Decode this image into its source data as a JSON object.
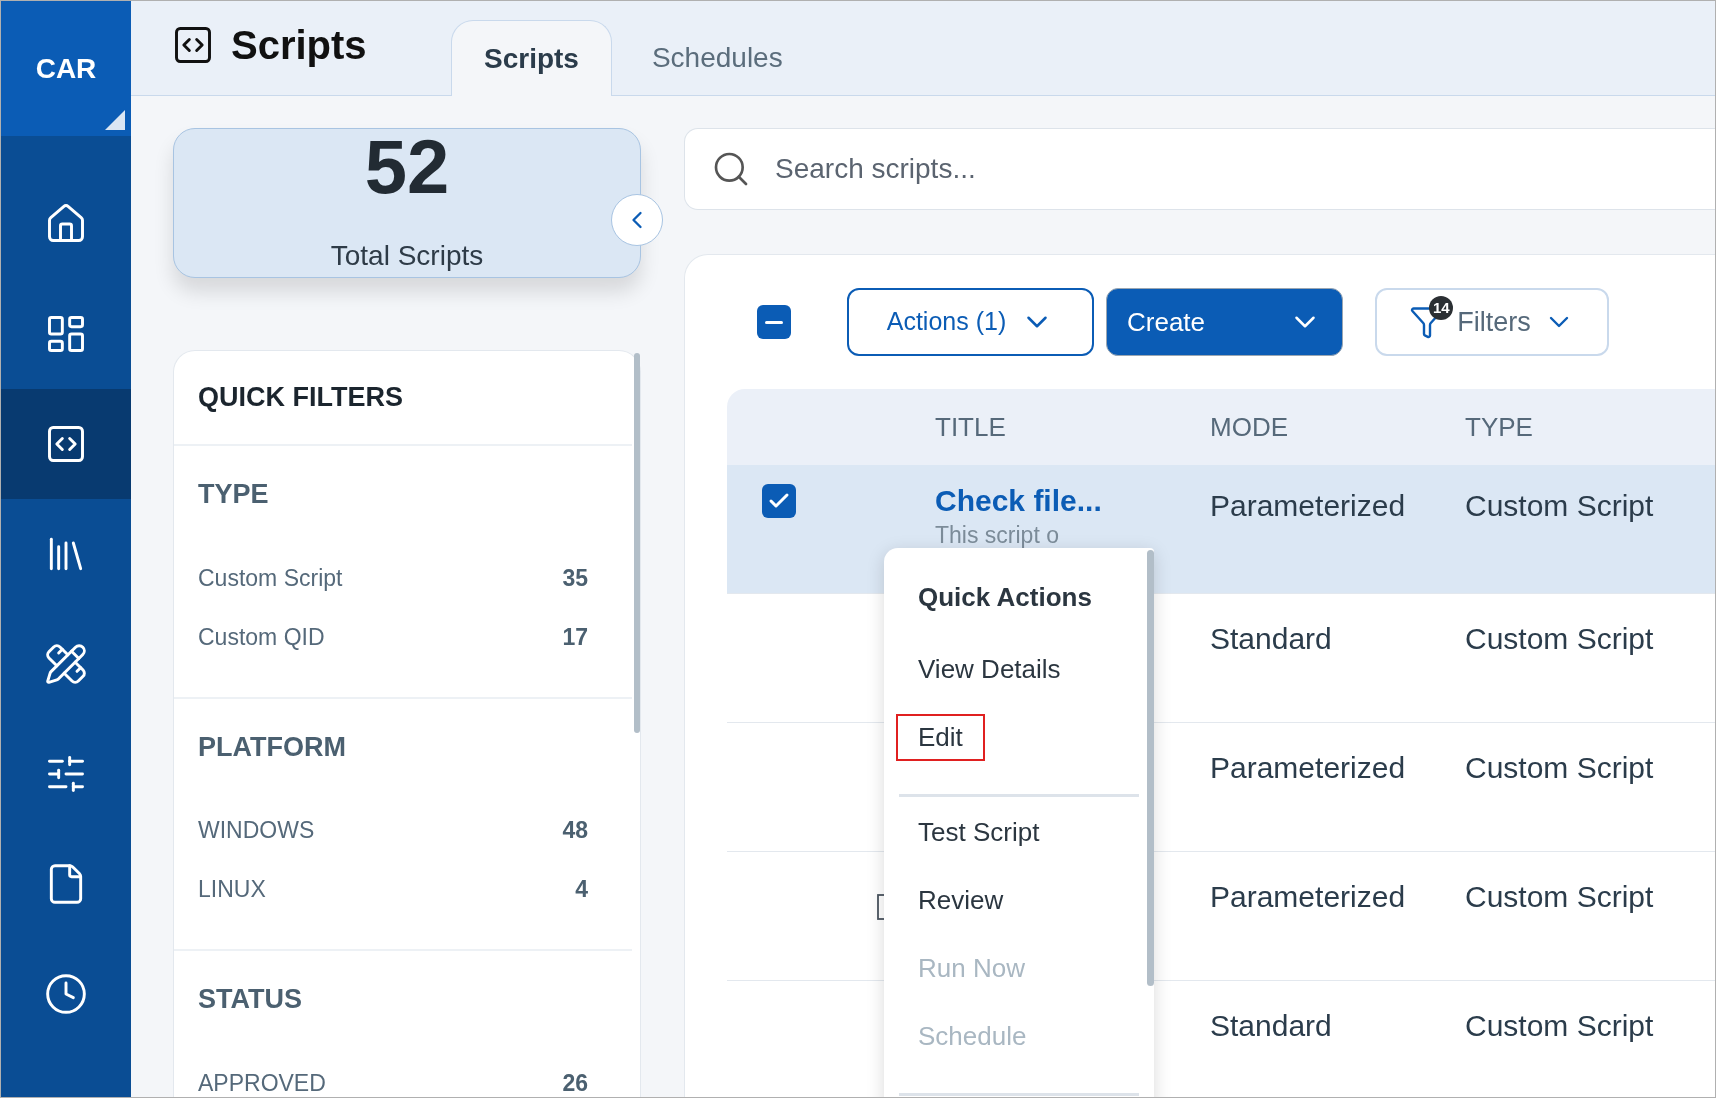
{
  "app": {
    "logo": "CAR"
  },
  "sidebar": {
    "items": [
      {
        "selected": false
      },
      {
        "selected": false
      },
      {
        "selected": true
      },
      {
        "selected": false
      },
      {
        "selected": false
      },
      {
        "selected": false
      },
      {
        "selected": false
      },
      {
        "selected": false
      }
    ]
  },
  "header": {
    "title": "Scripts",
    "tabs": [
      {
        "label": "Scripts",
        "selected": true
      },
      {
        "label": "Schedules",
        "selected": false
      }
    ]
  },
  "summary": {
    "count": "52",
    "label": "Total Scripts"
  },
  "quick_filters": {
    "title": "QUICK FILTERS",
    "sections": [
      {
        "title": "TYPE",
        "items": [
          {
            "label": "Custom Script",
            "count": "35"
          },
          {
            "label": "Custom QID",
            "count": "17"
          }
        ]
      },
      {
        "title": "PLATFORM",
        "items": [
          {
            "label": "WINDOWS",
            "count": "48"
          },
          {
            "label": "LINUX",
            "count": "4"
          }
        ]
      },
      {
        "title": "STATUS",
        "items": [
          {
            "label": "APPROVED",
            "count": "26"
          }
        ]
      }
    ]
  },
  "search": {
    "placeholder": "Search scripts..."
  },
  "toolbar": {
    "select_all": {
      "checked": true,
      "indeterminate": true
    },
    "actions": "Actions (1)",
    "create": "Create",
    "filters": "Filters",
    "filter_count": "14"
  },
  "table": {
    "columns": [
      "TITLE",
      "MODE",
      "TYPE"
    ],
    "rows": [
      {
        "selected": true,
        "title": "Check file...",
        "description": "This script o",
        "mode": "Parameterized",
        "type": "Custom Script",
        "library": false
      },
      {
        "selected": false,
        "mode": "Standard",
        "type": "Custom Script",
        "library": false
      },
      {
        "selected": false,
        "mode": "Parameterized",
        "type": "Custom Script",
        "library": false
      },
      {
        "selected": false,
        "mode": "Parameterized",
        "type": "Custom Script",
        "library": true
      },
      {
        "selected": false,
        "mode": "Standard",
        "type": "Custom Script",
        "library": false
      }
    ]
  },
  "context_menu": {
    "items": [
      {
        "kind": "header",
        "label": "Quick Actions"
      },
      {
        "kind": "item",
        "label": "View Details",
        "disabled": false,
        "highlighted": false
      },
      {
        "kind": "item",
        "label": "Edit",
        "disabled": false,
        "highlighted": true
      },
      {
        "kind": "divider"
      },
      {
        "kind": "item",
        "label": "Test Script",
        "disabled": false,
        "highlighted": false
      },
      {
        "kind": "item",
        "label": "Review",
        "disabled": false,
        "highlighted": false
      },
      {
        "kind": "item",
        "label": "Run Now",
        "disabled": true,
        "highlighted": false
      },
      {
        "kind": "item",
        "label": "Schedule",
        "disabled": true,
        "highlighted": false
      },
      {
        "kind": "divider"
      }
    ]
  }
}
